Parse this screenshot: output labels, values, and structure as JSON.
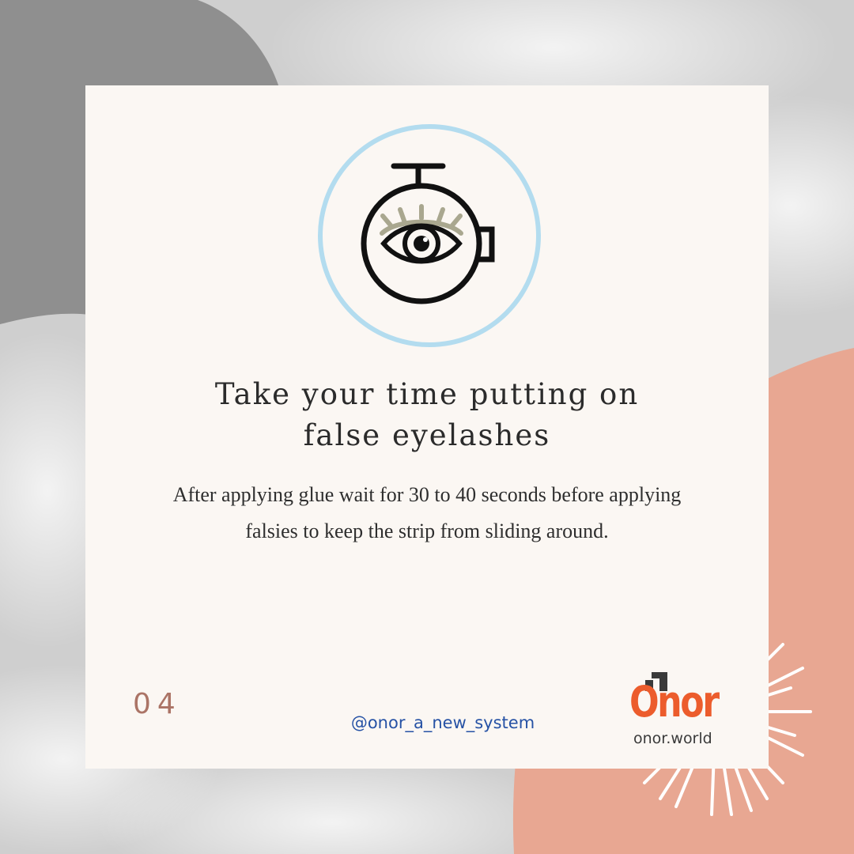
{
  "slide": {
    "title_lines": [
      "Take your time putting on",
      "false eyelashes"
    ],
    "body_lines": [
      "After applying glue wait for 30 to 40 seconds before applying",
      "falsies to keep the strip from sliding around."
    ],
    "number": "04",
    "handle": "@onor_a_new_system"
  },
  "brand": {
    "name": "Onor",
    "site": "onor.world"
  },
  "icon": {
    "name": "stopwatch-eye-icon",
    "ring_color": "#b3dcef",
    "stroke_color": "#111111",
    "lash_color": "#a9a78f"
  },
  "colors": {
    "card": "#fbf7f3",
    "accent_number": "#ab7466",
    "handle": "#2652a5",
    "logo": "#ec5c2c",
    "coral_blob": "#e8a792"
  }
}
